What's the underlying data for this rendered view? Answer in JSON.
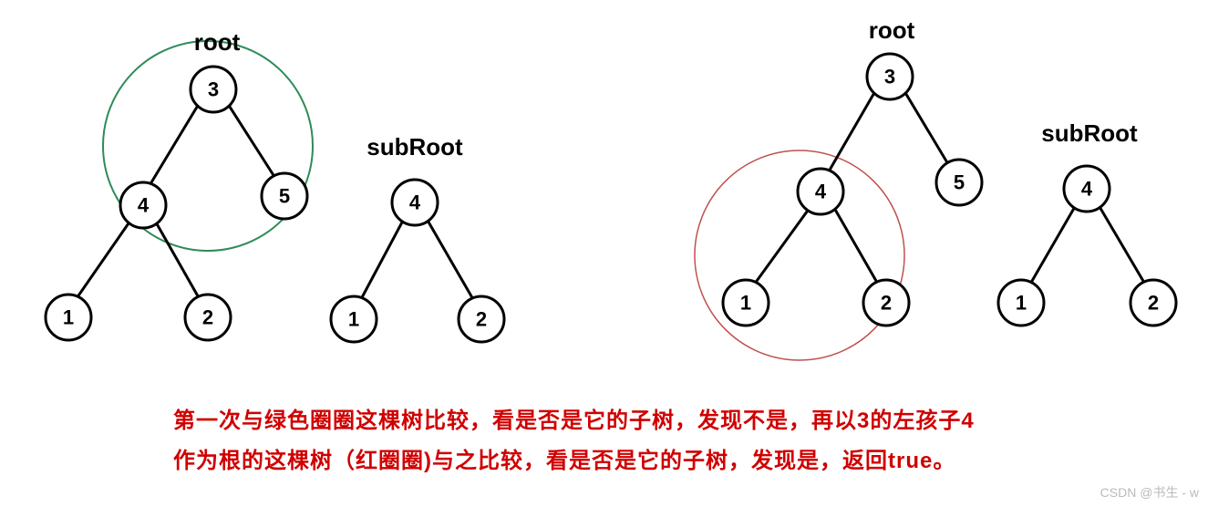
{
  "left_group": {
    "root_label": "root",
    "subroot_label": "subRoot",
    "root_tree": {
      "top": "3",
      "left_child": "4",
      "right_child": "5",
      "lleft": "1",
      "lright": "2"
    },
    "sub_tree": {
      "top": "4",
      "left_child": "1",
      "right_child": "2"
    }
  },
  "right_group": {
    "root_label": "root",
    "subroot_label": "subRoot",
    "root_tree": {
      "top": "3",
      "left_child": "4",
      "right_child": "5",
      "lleft": "1",
      "lright": "2"
    },
    "sub_tree": {
      "top": "4",
      "left_child": "1",
      "right_child": "2"
    }
  },
  "caption_line1": "第一次与绿色圈圈这棵树比较，看是否是它的子树，发现不是，再以3的左孩子4",
  "caption_line2": "作为根的这棵树（红圈圈)与之比较，看是否是它的子树，发现是，返回true。",
  "watermark": "CSDN @书生 - w",
  "colors": {
    "green": "#2e8b57",
    "red": "#c05050",
    "caption": "#d00000"
  }
}
